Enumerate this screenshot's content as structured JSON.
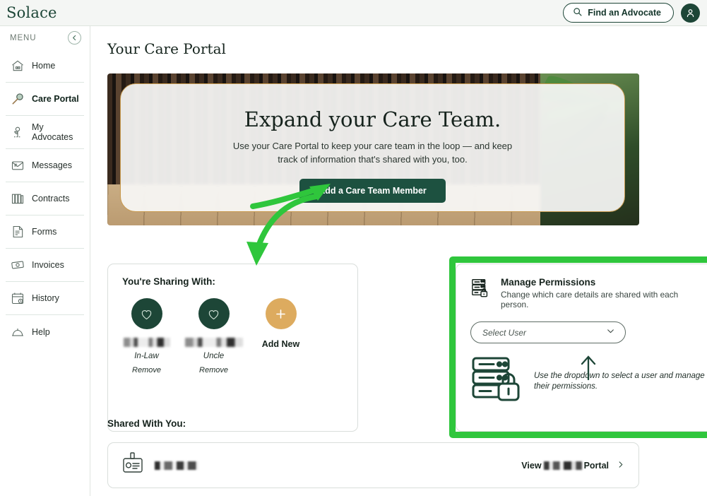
{
  "header": {
    "logo": "Solace",
    "find_advocate_label": "Find an Advocate",
    "search_icon": "search-icon",
    "avatar_icon": "user-avatar-icon"
  },
  "sidebar": {
    "menu_label": "MENU",
    "collapse_icon": "chevron-left-circle-icon",
    "items": [
      {
        "label": "Home",
        "icon": "house-icon",
        "active": false
      },
      {
        "label": "Care Portal",
        "icon": "key-icon",
        "active": true
      },
      {
        "label": "My Advocates",
        "icon": "flower-icon",
        "active": false
      },
      {
        "label": "Messages",
        "icon": "envelope-icon",
        "active": false
      },
      {
        "label": "Contracts",
        "icon": "books-icon",
        "active": false
      },
      {
        "label": "Forms",
        "icon": "form-icon",
        "active": false
      },
      {
        "label": "Invoices",
        "icon": "money-icon",
        "active": false
      },
      {
        "label": "History",
        "icon": "calendar-clock-icon",
        "active": false
      },
      {
        "label": "Help",
        "icon": "bell-icon",
        "active": false
      }
    ]
  },
  "main": {
    "page_title": "Your Care Portal",
    "hero": {
      "title": "Expand your Care Team.",
      "subtitle": "Use your Care Portal to keep your care team in the loop — and keep track of information that's shared with you, too.",
      "button_label": "Add a Care Team Member"
    },
    "sharing": {
      "heading": "You're Sharing With:",
      "people": [
        {
          "name_redacted": true,
          "relation": "In-Law",
          "remove_label": "Remove",
          "icon": "heart-icon"
        },
        {
          "name_redacted": true,
          "relation": "Uncle",
          "remove_label": "Remove",
          "icon": "heart-icon"
        }
      ],
      "add_new_label": "Add New",
      "add_icon": "plus-icon"
    },
    "permissions": {
      "icon": "server-lock-icon",
      "title": "Manage Permissions",
      "description": "Change which care details are shared with each person.",
      "collapse_icon": "chevron-down-icon",
      "select_user_placeholder": "Select User",
      "select_user_chevron": "chevron-down-icon",
      "illustration_icon": "server-lock-illustration",
      "hint_text": "Use the dropdown to select a user and manage their permissions.",
      "hint_arrow_icon": "arrow-up-icon"
    },
    "shared_with_you": {
      "heading": "Shared With You:",
      "row": {
        "icon": "id-badge-icon",
        "name_redacted": true,
        "view_prefix": "View",
        "view_suffix": "Portal",
        "chevron_icon": "chevron-right-icon"
      }
    }
  },
  "annotations": {
    "highlight_color": "#2fc63c",
    "arrow_to_add_new": "arrow-pointing-down-to-add-new",
    "arrow_to_hero_button": "arrow-pointing-up-right-to-add-care-team-member"
  },
  "colors": {
    "brand_green": "#1d4637",
    "button_green": "#1d5140",
    "amber": "#ddab5f",
    "hero_border": "#c99a4e",
    "annotation_green": "#2fc63c"
  }
}
